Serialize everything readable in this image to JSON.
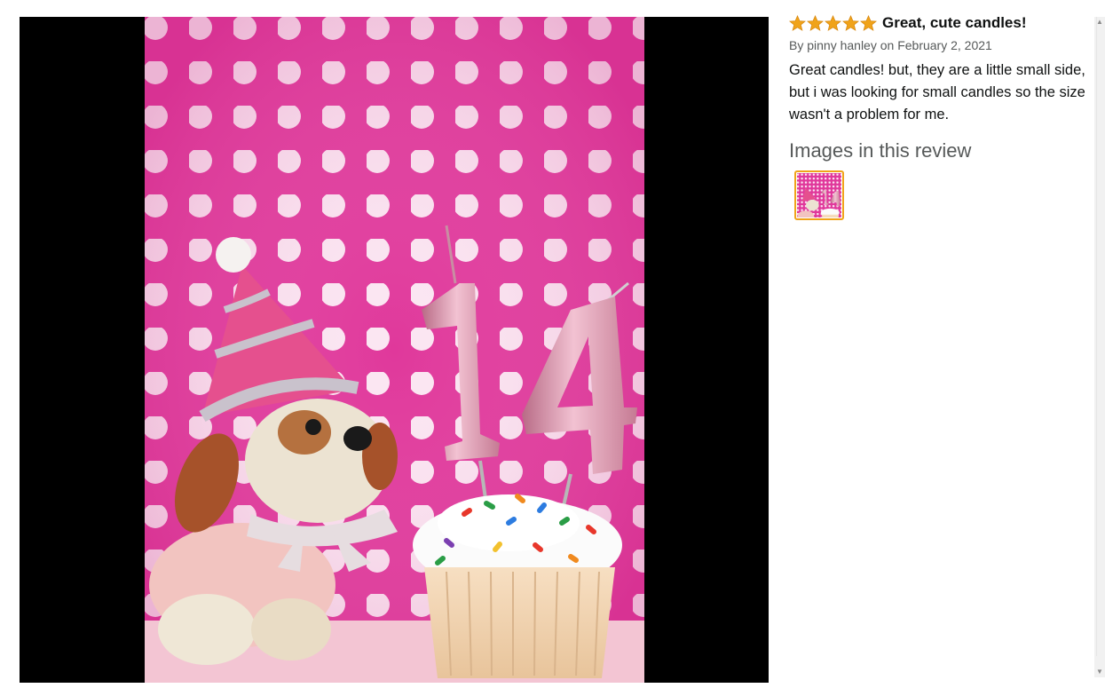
{
  "photo": {
    "alt_subject": "plush puppy wearing party hat next to cupcake with number 14 candles",
    "background_color": "#e0389b",
    "dot_color": "#fbe6f2",
    "candle_color": "#d98fa8"
  },
  "review": {
    "rating": 5,
    "star_color": "#f0a31a",
    "title": "Great, cute candles!",
    "byline": "By pinny hanley on February 2, 2021",
    "body": "Great candles! but, they are a little small side, but i was looking for small candles so the size wasn't a problem for me.",
    "images_heading": "Images in this review",
    "thumbnail_border_color": "#f0a31a"
  }
}
